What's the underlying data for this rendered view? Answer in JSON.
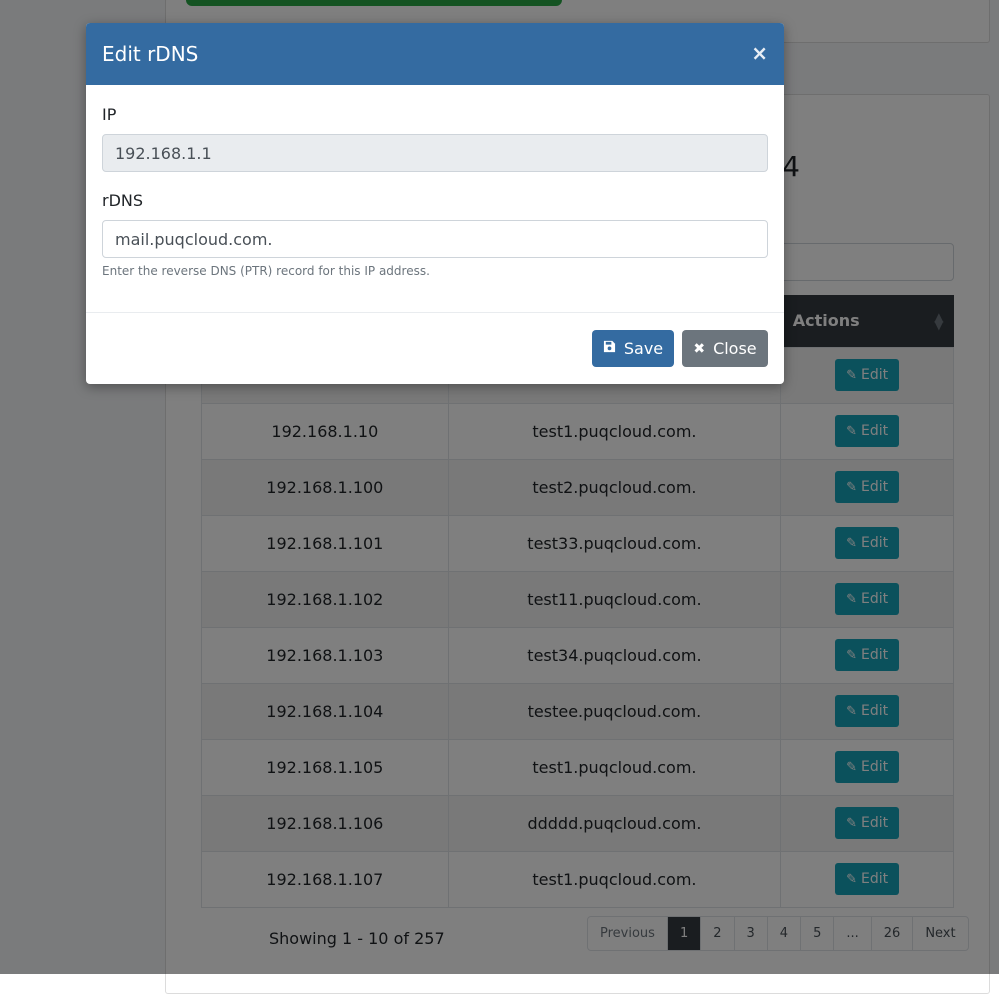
{
  "background": {
    "heading_fragment": "4",
    "table": {
      "actions_header": "Actions",
      "edit_label": "Edit",
      "rows": [
        {
          "ip": "",
          "rdns": ""
        },
        {
          "ip": "192.168.1.10",
          "rdns": "test1.puqcloud.com."
        },
        {
          "ip": "192.168.1.100",
          "rdns": "test2.puqcloud.com."
        },
        {
          "ip": "192.168.1.101",
          "rdns": "test33.puqcloud.com."
        },
        {
          "ip": "192.168.1.102",
          "rdns": "test11.puqcloud.com."
        },
        {
          "ip": "192.168.1.103",
          "rdns": "test34.puqcloud.com."
        },
        {
          "ip": "192.168.1.104",
          "rdns": "testee.puqcloud.com."
        },
        {
          "ip": "192.168.1.105",
          "rdns": "test1.puqcloud.com."
        },
        {
          "ip": "192.168.1.106",
          "rdns": "ddddd.puqcloud.com."
        },
        {
          "ip": "192.168.1.107",
          "rdns": "test1.puqcloud.com."
        }
      ]
    },
    "showing_text": "Showing 1 - 10 of 257",
    "pagination": {
      "previous": "Previous",
      "pages": [
        "1",
        "2",
        "3",
        "4",
        "5",
        "...",
        "26"
      ],
      "next": "Next",
      "active": "1"
    }
  },
  "modal": {
    "title": "Edit rDNS",
    "close_symbol": "×",
    "ip_label": "IP",
    "ip_value": "192.168.1.1",
    "rdns_label": "rDNS",
    "rdns_value": "mail.puqcloud.com.",
    "help_text": "Enter the reverse DNS (PTR) record for this IP address.",
    "save_label": "Save",
    "close_label": "Close"
  },
  "icons": {
    "edit": "edit-icon",
    "save": "floppy-disk-icon",
    "close": "x-icon"
  },
  "colors": {
    "header_blue": "#346ba1",
    "edit_teal": "#17a2b8",
    "close_gray": "#6c757d",
    "table_head": "#343a40",
    "progress_green": "#28a745"
  }
}
